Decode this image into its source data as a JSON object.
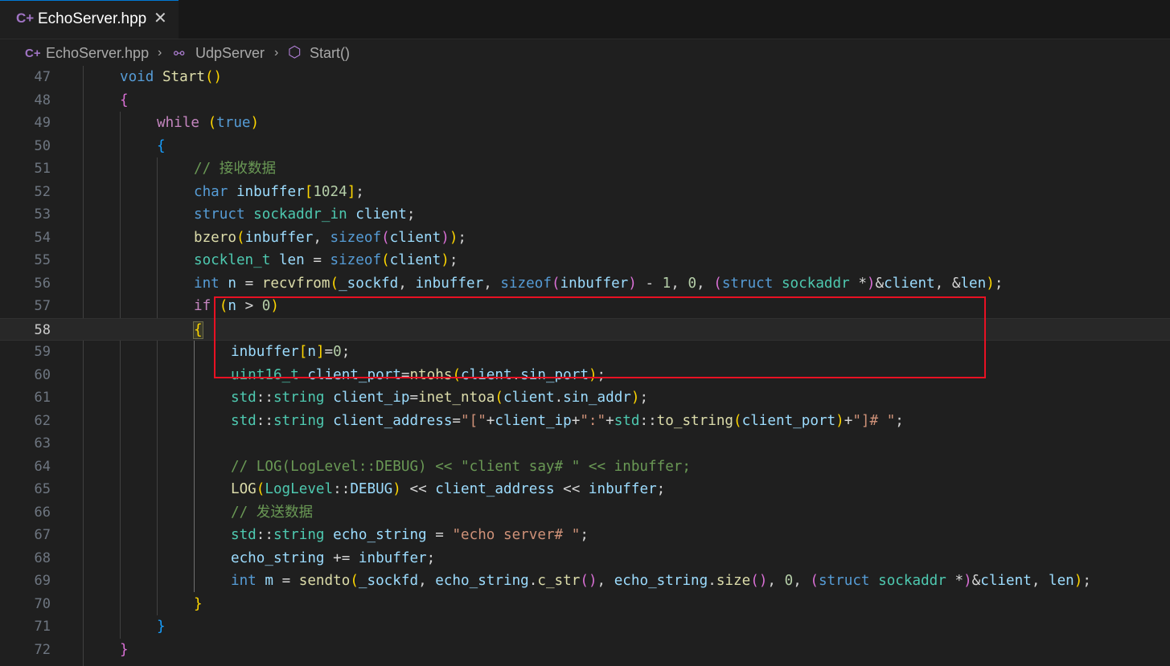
{
  "tab": {
    "title": "EchoServer.hpp",
    "close_icon": "close-icon"
  },
  "breadcrumb": {
    "file": "EchoServer.hpp",
    "class": "UdpServer",
    "method": "Start()"
  },
  "code": {
    "line_numbers": [
      "47",
      "48",
      "49",
      "50",
      "51",
      "52",
      "53",
      "54",
      "55",
      "56",
      "57",
      "58",
      "59",
      "60",
      "61",
      "62",
      "63",
      "64",
      "65",
      "66",
      "67",
      "68",
      "69",
      "70",
      "71",
      "72"
    ],
    "active_line": "58",
    "lines": [
      "void Start()",
      "{",
      "while (true)",
      "{",
      "// 接收数据",
      "char inbuffer[1024];",
      "struct sockaddr_in client;",
      "bzero(inbuffer, sizeof(client));",
      "socklen_t len = sizeof(client);",
      "int n = recvfrom(_sockfd, inbuffer, sizeof(inbuffer) - 1, 0, (struct sockaddr *)&client, &len);",
      "if (n > 0)",
      "{",
      "inbuffer[n]=0;",
      "uint16_t client_port=ntohs(client.sin_port);",
      "std::string client_ip=inet_ntoa(client.sin_addr);",
      "std::string client_address=\"[\"+client_ip+\":\"+std::to_string(client_port)+\"]# \";",
      "",
      "// LOG(LogLevel::DEBUG) << \"client say# \" << inbuffer;",
      "LOG(LogLevel::DEBUG) << client_address << inbuffer;",
      "// 发送数据",
      "std::string echo_string = \"echo server# \";",
      "echo_string += inbuffer;",
      "int m = sendto(_sockfd, echo_string.c_str(), echo_string.size(), 0, (struct sockaddr *)&client, len);",
      "}",
      "}",
      "}"
    ]
  },
  "colors": {
    "highlight_box": "#e81123",
    "background": "#1f1f1f",
    "keyword": "#569cd6",
    "control": "#c586c0",
    "function": "#dcdcaa",
    "type": "#4ec9b0",
    "variable": "#9cdcfe",
    "string": "#ce9178",
    "comment": "#6a9955"
  }
}
